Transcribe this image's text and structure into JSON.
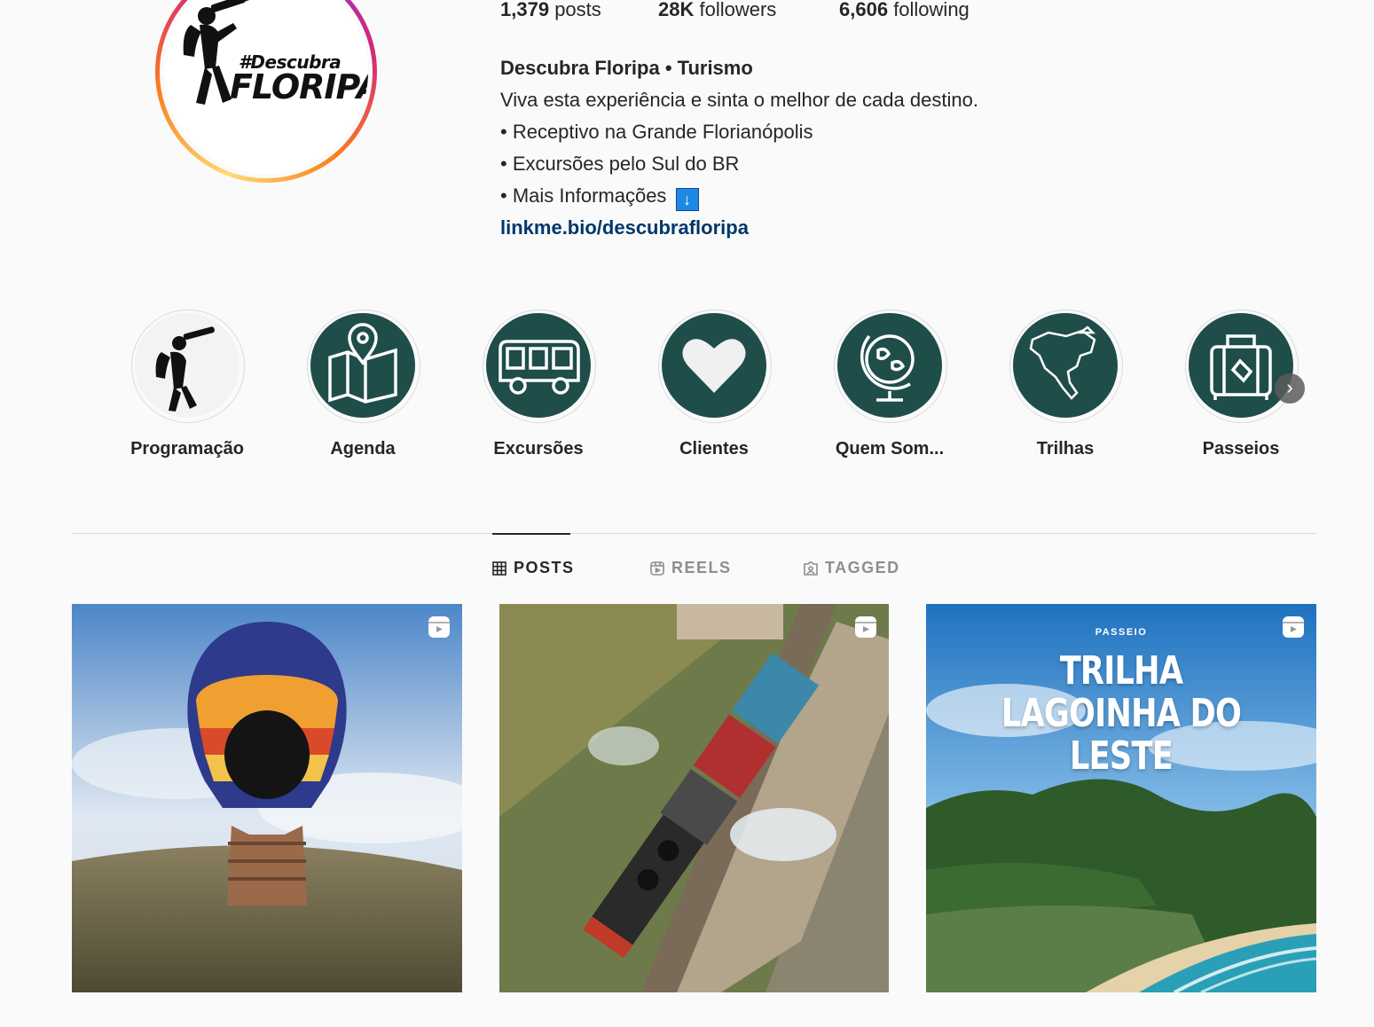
{
  "profile": {
    "avatar_logo_line1": "#Descubra",
    "avatar_logo_line2": "FLORIPA",
    "stats": {
      "posts_count": "1,379",
      "posts_label": "posts",
      "followers_count": "28K",
      "followers_label": "followers",
      "following_count": "6,606",
      "following_label": "following"
    },
    "bio": {
      "name": "Descubra Floripa • Turismo",
      "line1": "Viva esta experiência e sinta o melhor de cada destino.",
      "line2": "• Receptivo na Grande Florianópolis",
      "line3": "• Excursões pelo Sul do BR",
      "line4": "• Mais Informações",
      "arrow_emoji": "↓",
      "link": "linkme.bio/descubrafloripa"
    }
  },
  "highlights": {
    "items": [
      {
        "label": "Programação",
        "icon": "hiker-binoculars-icon"
      },
      {
        "label": "Agenda",
        "icon": "map-pin-icon"
      },
      {
        "label": "Excursões",
        "icon": "bus-icon"
      },
      {
        "label": "Clientes",
        "icon": "heart-icon"
      },
      {
        "label": "Quem Som...",
        "icon": "globe-icon"
      },
      {
        "label": "Trilhas",
        "icon": "north-america-map-icon"
      },
      {
        "label": "Passeios",
        "icon": "suitcase-icon"
      }
    ],
    "next_icon": "›"
  },
  "tabs": {
    "posts": "POSTS",
    "reels": "REELS",
    "tagged": "TAGGED"
  },
  "posts": [
    {
      "type": "reel",
      "subject": "hot-air-balloon"
    },
    {
      "type": "reel",
      "subject": "steam-train"
    },
    {
      "type": "reel",
      "subject": "beach-trail",
      "tag": "PASSEIO",
      "title_line1": "TRILHA",
      "title_line2": "LAGOINHA DO LESTE"
    }
  ],
  "colors": {
    "highlight_bg": "#1f4e4a",
    "link": "#00376b",
    "accent_ring_start": "#feda75",
    "accent_ring_end": "#d62976"
  }
}
